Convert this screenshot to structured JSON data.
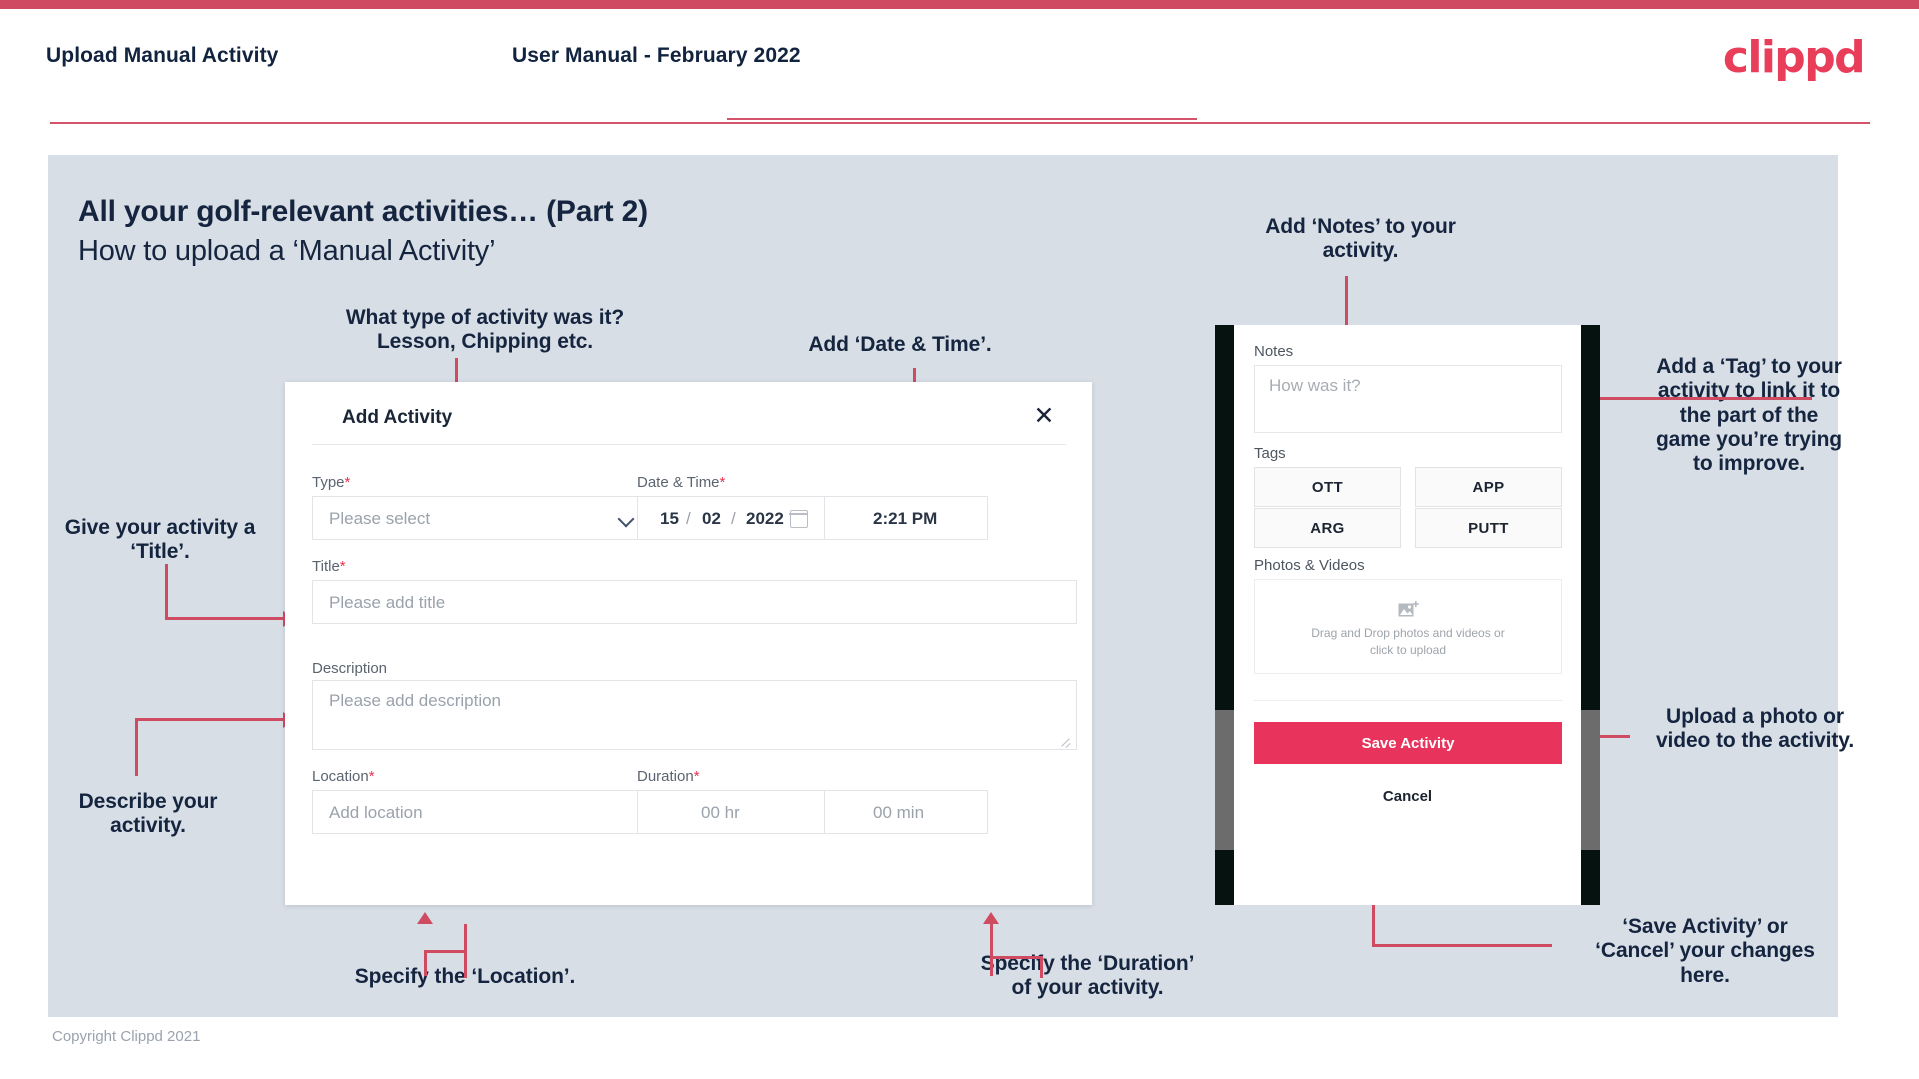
{
  "header": {
    "title": "Upload Manual Activity",
    "subtitle": "User Manual - February 2022",
    "logo": "clippd"
  },
  "slide": {
    "heading": "All your golf-relevant activities… (Part 2)",
    "subheading": "How to upload a ‘Manual Activity’"
  },
  "footer": {
    "copyright": "Copyright Clippd 2021"
  },
  "colors": {
    "brand_pink": "#e8335c",
    "accent_line": "#cf4b61",
    "slide_bg": "#d8dee6",
    "text_dark": "#15253f",
    "required_star": "#e8344e"
  },
  "dialog": {
    "title": "Add Activity",
    "close_icon": "close-icon",
    "fields": {
      "type": {
        "label": "Type",
        "required": "*",
        "placeholder": "Please select",
        "chevron": "chevron-down-icon"
      },
      "datetime": {
        "label": "Date & Time",
        "required": "*",
        "day": "15",
        "sep1": "/",
        "month": "02",
        "sep2": "/",
        "year": "2022",
        "calendar_icon": "calendar-icon",
        "time": "2:21 PM"
      },
      "title": {
        "label": "Title",
        "required": "*",
        "placeholder": "Please add title"
      },
      "description": {
        "label": "Description",
        "placeholder": "Please add description"
      },
      "location": {
        "label": "Location",
        "required": "*",
        "placeholder": "Add location"
      },
      "duration": {
        "label": "Duration",
        "required": "*",
        "hours": "00 hr",
        "minutes": "00 min"
      }
    }
  },
  "phone": {
    "notes": {
      "label": "Notes",
      "placeholder": "How was it?"
    },
    "tags": {
      "label": "Tags",
      "items": [
        "OTT",
        "APP",
        "ARG",
        "PUTT"
      ]
    },
    "photos": {
      "label": "Photos & Videos",
      "icon": "add-image-icon",
      "hint_line1": "Drag and Drop photos and videos or",
      "hint_line2": "click to upload"
    },
    "save_label": "Save Activity",
    "cancel_label": "Cancel"
  },
  "annotations": {
    "type": "What type of activity was it?\nLesson, Chipping etc.",
    "datetime": "Add ‘Date & Time’.",
    "notes": "Add ‘Notes’ to your\nactivity.",
    "tags": "Add a ‘Tag’ to your\nactivity to link it to\nthe part of the\ngame you’re trying\nto improve.",
    "title": "Give your activity a\n‘Title’.",
    "description": "Describe your\nactivity.",
    "location": "Specify the ‘Location’.",
    "duration": "Specify the ‘Duration’\nof your activity.",
    "photos": "Upload a photo or\nvideo to the activity.",
    "save": "‘Save Activity’ or\n‘Cancel’ your changes\nhere."
  }
}
